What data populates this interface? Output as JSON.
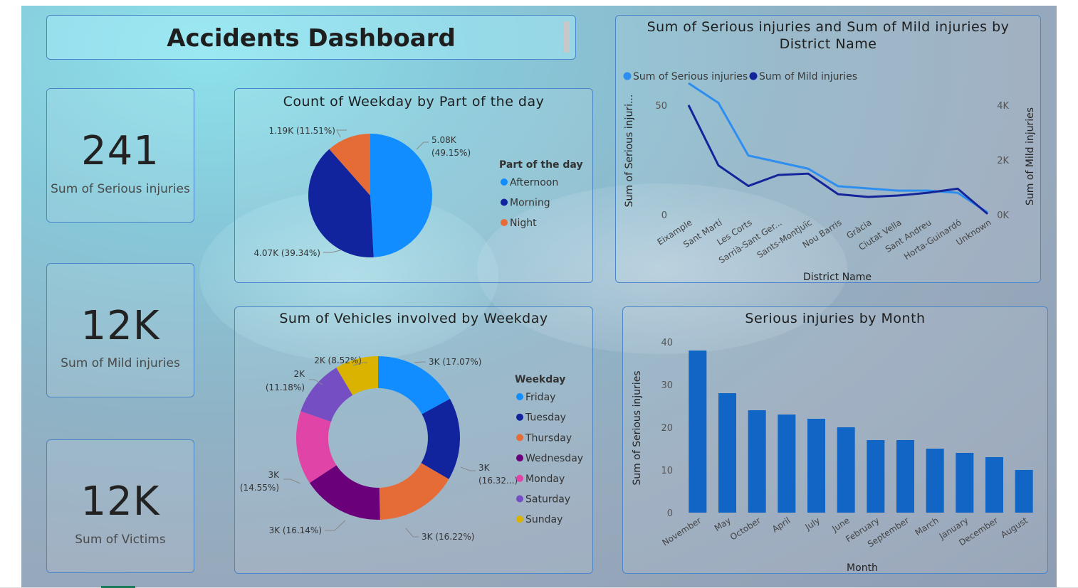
{
  "dashboard": {
    "title": "Accidents Dashboard"
  },
  "kpis": [
    {
      "value": "241",
      "label": "Sum of Serious injuries"
    },
    {
      "value": "12K",
      "label": "Sum of Mild injuries"
    },
    {
      "value": "12K",
      "label": "Sum of Victims"
    }
  ],
  "colors": {
    "afternoon": "#118DFF",
    "morning": "#12239E",
    "night": "#E66C37",
    "friday": "#118DFF",
    "tuesday": "#12239E",
    "thursday": "#E66C37",
    "wednesday": "#6B007B",
    "monday": "#E044A7",
    "saturday": "#744EC2",
    "sunday": "#D9B300",
    "serious_line": "#2e8ef0",
    "mild_line": "#14249a",
    "bar": "#1166c5"
  },
  "chart_data": [
    {
      "id": "pie",
      "type": "pie",
      "title": "Count of Weekday by Part of the day",
      "legend_title": "Part of the day",
      "legend_position": "right",
      "slices": [
        {
          "name": "Afternoon",
          "value": 5080,
          "label": "5.08K (49.15%)",
          "color": "#118DFF"
        },
        {
          "name": "Morning",
          "value": 4070,
          "label": "4.07K (39.34%)",
          "color": "#12239E"
        },
        {
          "name": "Night",
          "value": 1190,
          "label": "1.19K (11.51%)",
          "color": "#E66C37"
        }
      ]
    },
    {
      "id": "line",
      "type": "line",
      "title": "Sum of Serious injuries and Sum of Mild injuries by District Name",
      "xlabel": "District Name",
      "ylabel": "Sum of Serious injuri...",
      "y2label": "Sum of Mild injuries",
      "legend_position": "top-left",
      "categories": [
        "Eixample",
        "Sant Martí",
        "Les Corts",
        "Sarrià-Sant Ger...",
        "Sants-Montjuïc",
        "Nou Barris",
        "Gràcia",
        "Ciutat Vella",
        "Sant Andreu",
        "Horta-Guinardó",
        "Unknown"
      ],
      "yticks": [
        "0",
        "50"
      ],
      "y2ticks": [
        "0K",
        "2K",
        "4K"
      ],
      "ylim": [
        0,
        60
      ],
      "y2lim": [
        0,
        4800
      ],
      "series": [
        {
          "name": "Sum of Serious injuries",
          "axis": "left",
          "color": "#2e8ef0",
          "values": [
            60,
            51,
            27,
            24,
            21,
            13,
            12,
            11,
            11,
            10,
            1
          ]
        },
        {
          "name": "Sum of Mild injuries",
          "axis": "right",
          "color": "#14249a",
          "values": [
            4000,
            1800,
            1050,
            1450,
            1500,
            750,
            650,
            700,
            800,
            950,
            30
          ]
        }
      ]
    },
    {
      "id": "donut",
      "type": "pie",
      "title": "Sum of Vehicles involved by Weekday",
      "legend_title": "Weekday",
      "legend_position": "right",
      "slices": [
        {
          "name": "Friday",
          "value": 17.07,
          "label": "3K (17.07%)",
          "color": "#118DFF"
        },
        {
          "name": "Tuesday",
          "value": 16.32,
          "label": "3K (16.32...)",
          "color": "#12239E"
        },
        {
          "name": "Thursday",
          "value": 16.22,
          "label": "3K (16.22%)",
          "color": "#E66C37"
        },
        {
          "name": "Wednesday",
          "value": 16.14,
          "label": "3K (16.14%)",
          "color": "#6B007B"
        },
        {
          "name": "Monday",
          "value": 14.55,
          "label": "3K (14.55%)",
          "color": "#E044A7"
        },
        {
          "name": "Saturday",
          "value": 11.18,
          "label": "2K (11.18%)",
          "color": "#744EC2"
        },
        {
          "name": "Sunday",
          "value": 8.52,
          "label": "2K (8.52%)",
          "color": "#D9B300"
        }
      ]
    },
    {
      "id": "bar",
      "type": "bar",
      "title": "Serious injuries by Month",
      "xlabel": "Month",
      "ylabel": "Sum of Serious injuries",
      "ylim": [
        0,
        40
      ],
      "yticks": [
        "0",
        "10",
        "20",
        "30",
        "40"
      ],
      "categories": [
        "November",
        "May",
        "October",
        "April",
        "July",
        "June",
        "February",
        "September",
        "March",
        "January",
        "December",
        "August"
      ],
      "values": [
        38,
        28,
        24,
        23,
        22,
        20,
        17,
        17,
        15,
        14,
        13,
        10
      ]
    }
  ]
}
